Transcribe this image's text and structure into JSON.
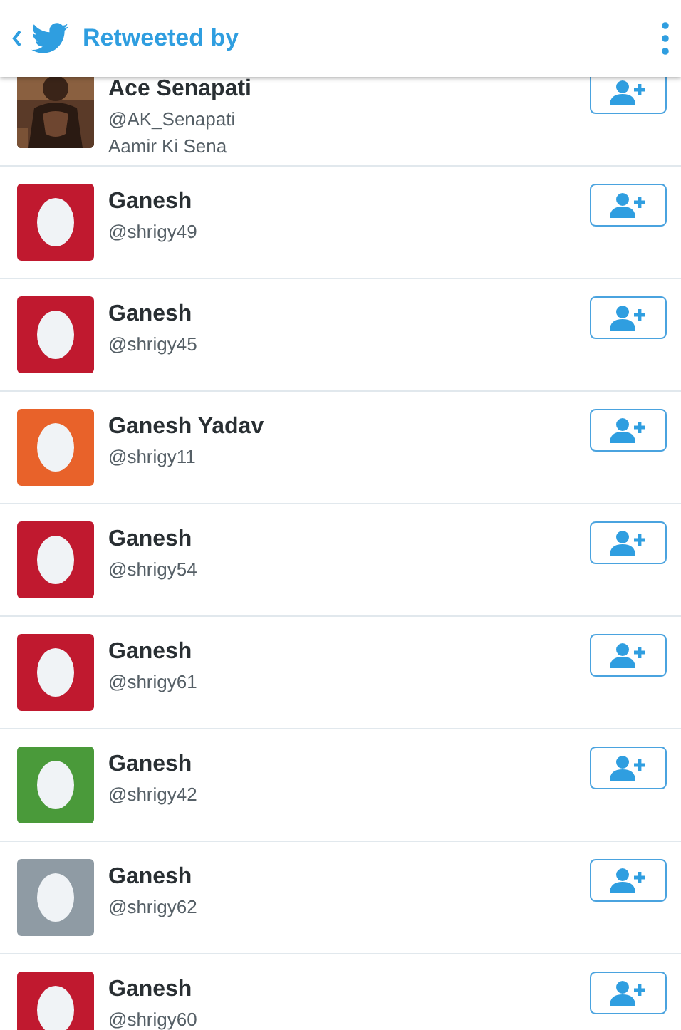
{
  "header": {
    "title": "Retweeted by"
  },
  "users": [
    {
      "name": "Ace Senapati",
      "handle": "@AK_Senapati",
      "bio": "Aamir Ki Sena"
    },
    {
      "name": "Ganesh",
      "handle": "@shrigy49",
      "avatar": {
        "kind": "egg",
        "color": "#c0192f"
      }
    },
    {
      "name": "Ganesh",
      "handle": "@shrigy45",
      "avatar": {
        "kind": "egg",
        "color": "#c0192f"
      }
    },
    {
      "name": "Ganesh Yadav",
      "handle": "@shrigy11",
      "avatar": {
        "kind": "egg",
        "color": "#e8622a"
      }
    },
    {
      "name": "Ganesh",
      "handle": "@shrigy54",
      "avatar": {
        "kind": "egg",
        "color": "#c0192f"
      }
    },
    {
      "name": "Ganesh",
      "handle": "@shrigy61",
      "avatar": {
        "kind": "egg",
        "color": "#c0192f"
      }
    },
    {
      "name": "Ganesh",
      "handle": "@shrigy42",
      "avatar": {
        "kind": "egg",
        "color": "#4a9a3a"
      }
    },
    {
      "name": "Ganesh",
      "handle": "@shrigy62",
      "avatar": {
        "kind": "egg",
        "color": "#8f9ba4"
      }
    },
    {
      "name": "Ganesh",
      "handle": "@shrigy60",
      "avatar": {
        "kind": "egg",
        "color": "#c0192f"
      }
    }
  ]
}
